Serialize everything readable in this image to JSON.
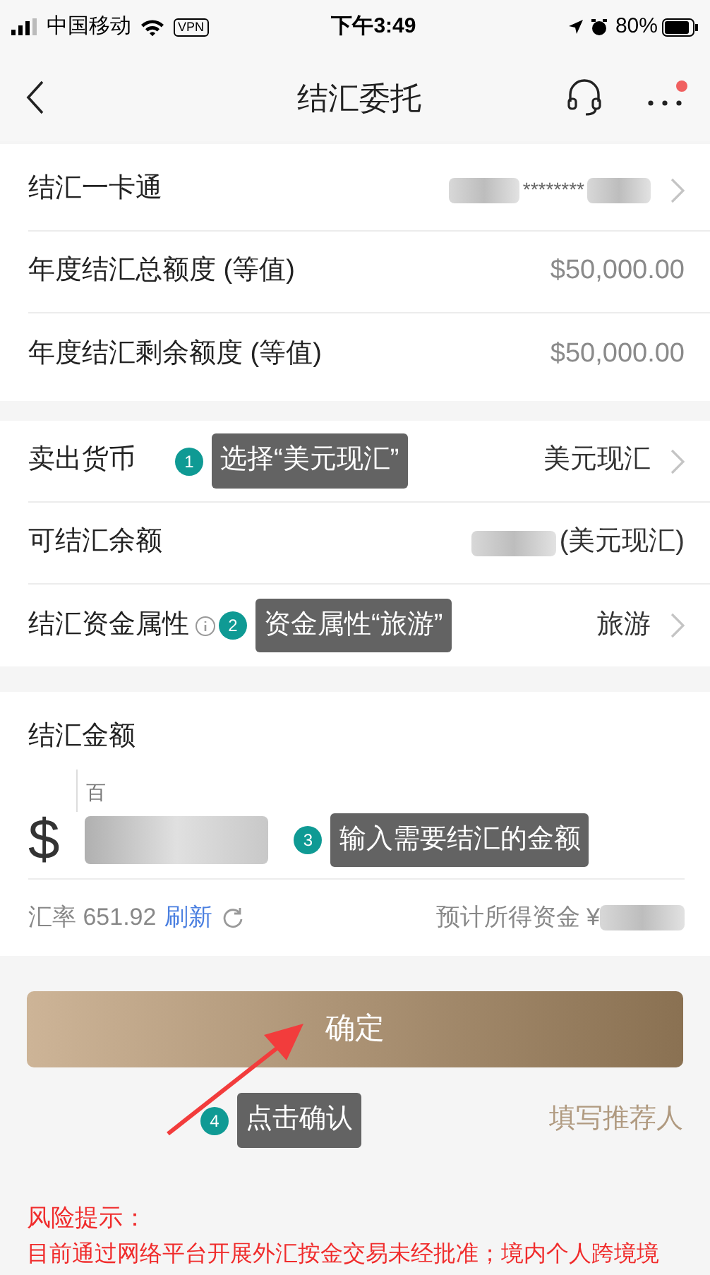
{
  "status_bar": {
    "carrier": "中国移动",
    "vpn": "VPN",
    "time": "下午3:49",
    "battery": "80%"
  },
  "nav": {
    "title": "结汇委托",
    "menu_badge": true
  },
  "account_rows": [
    {
      "kind": "masked-card",
      "label": "结汇一卡通",
      "value": "********",
      "chevron": true
    },
    {
      "kind": "plain",
      "label": "年度结汇总额度 (等值)",
      "value": "$50,000.00",
      "chevron": false
    },
    {
      "kind": "plain",
      "label": "年度结汇剩余额度 (等值)",
      "value": "$50,000.00",
      "chevron": false
    }
  ],
  "sell_rows": [
    {
      "kind": "plain",
      "label": "卖出货币",
      "value": "美元现汇",
      "chevron": true,
      "info": false,
      "annotation": {
        "number": "1",
        "text": "选择“美元现汇”"
      }
    },
    {
      "kind": "masked-balance",
      "label": "可结汇余额",
      "value": "(美元现汇)",
      "chevron": false,
      "info": false
    },
    {
      "kind": "plain",
      "label": "结汇资金属性",
      "value": "旅游",
      "chevron": true,
      "info": true,
      "annotation": {
        "number": "2",
        "text": "资金属性“旅游”"
      }
    }
  ],
  "amount": {
    "label": "结汇金额",
    "unit_hint": "百",
    "currency": "$",
    "annotation": {
      "number": "3",
      "text": "输入需要结汇的金额"
    }
  },
  "rate": {
    "label": "汇率 651.92",
    "refresh": "刷新",
    "estimate_label": "预计所得资金 ¥"
  },
  "confirm_button": "确定",
  "confirm_annotation": {
    "number": "4",
    "text": "点击确认"
  },
  "referrer_link": "填写推荐人",
  "risk": {
    "title": "风险提示：",
    "text": "目前通过网络平台开展外汇按金交易未经批准；境内个人跨境境"
  }
}
